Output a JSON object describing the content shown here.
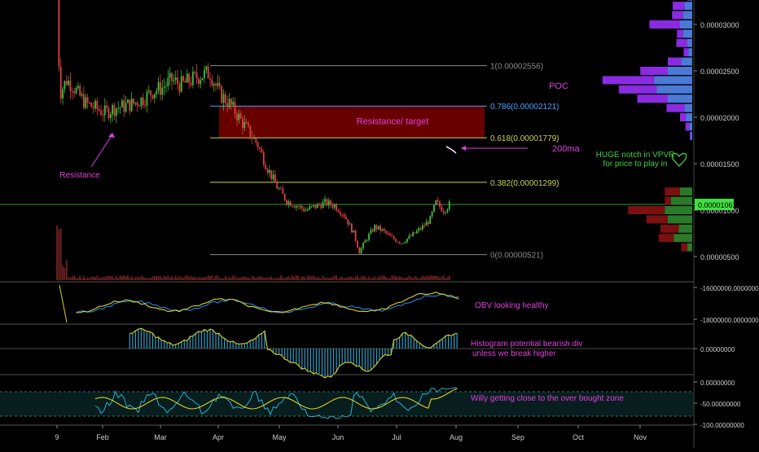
{
  "chart_data": {
    "type": "candlestick",
    "x_axis": {
      "labels": [
        "9",
        "Feb",
        "Mar",
        "Apr",
        "May",
        "Jun",
        "Jul",
        "Aug",
        "Sep",
        "Oct",
        "Nov"
      ]
    },
    "price_axis": {
      "ticks": [
        "0.00003000",
        "0.00002500",
        "0.00002000",
        "0.00001500",
        "0.00001000",
        "0.00000500"
      ],
      "current_price": "0.00001061"
    },
    "price_series": [
      {
        "t": 0,
        "v": 3.55e-05
      },
      {
        "t": 1,
        "v": 2.6e-05
      },
      {
        "t": 2,
        "v": 2.28e-05
      },
      {
        "t": 5,
        "v": 2.4e-05
      },
      {
        "t": 8,
        "v": 2.35e-05
      },
      {
        "t": 11,
        "v": 2.25e-05
      },
      {
        "t": 15,
        "v": 2.15e-05
      },
      {
        "t": 20,
        "v": 2.1e-05
      },
      {
        "t": 25,
        "v": 2.05e-05
      },
      {
        "t": 30,
        "v": 2.1e-05
      },
      {
        "t": 35,
        "v": 2.12e-05
      },
      {
        "t": 40,
        "v": 2.15e-05
      },
      {
        "t": 45,
        "v": 2.2e-05
      },
      {
        "t": 50,
        "v": 2.28e-05
      },
      {
        "t": 55,
        "v": 2.32e-05
      },
      {
        "t": 60,
        "v": 2.4e-05
      },
      {
        "t": 65,
        "v": 2.35e-05
      },
      {
        "t": 70,
        "v": 2.4e-05
      },
      {
        "t": 75,
        "v": 2.45e-05
      },
      {
        "t": 80,
        "v": 2.48e-05
      },
      {
        "t": 85,
        "v": 2.25e-05
      },
      {
        "t": 90,
        "v": 2.15e-05
      },
      {
        "t": 95,
        "v": 2e-05
      },
      {
        "t": 100,
        "v": 1.85e-05
      },
      {
        "t": 105,
        "v": 1.7e-05
      },
      {
        "t": 110,
        "v": 1.45e-05
      },
      {
        "t": 115,
        "v": 1.25e-05
      },
      {
        "t": 120,
        "v": 1.1e-05
      },
      {
        "t": 125,
        "v": 1.05e-05
      },
      {
        "t": 130,
        "v": 1e-05
      },
      {
        "t": 135,
        "v": 1.04e-05
      },
      {
        "t": 140,
        "v": 1.08e-05
      },
      {
        "t": 145,
        "v": 1.05e-05
      },
      {
        "t": 150,
        "v": 9.5e-06
      },
      {
        "t": 155,
        "v": 7.5e-06
      },
      {
        "t": 158,
        "v": 5.5e-06
      },
      {
        "t": 162,
        "v": 7e-06
      },
      {
        "t": 166,
        "v": 8.2e-06
      },
      {
        "t": 170,
        "v": 7.8e-06
      },
      {
        "t": 175,
        "v": 7e-06
      },
      {
        "t": 180,
        "v": 6.5e-06
      },
      {
        "t": 185,
        "v": 7.2e-06
      },
      {
        "t": 190,
        "v": 8e-06
      },
      {
        "t": 195,
        "v": 9e-06
      },
      {
        "t": 198,
        "v": 1.08e-05
      },
      {
        "t": 202,
        "v": 1e-05
      },
      {
        "t": 205,
        "v": 1.06e-05
      }
    ],
    "fib_levels": [
      {
        "label": "1(0.00002556)",
        "price": 2.556e-05
      },
      {
        "label": "0.786(0.00002121)",
        "price": 2.121e-05
      },
      {
        "label": "0.618(0.00001779)",
        "price": 1.779e-05
      },
      {
        "label": "0.382(0.00001299)",
        "price": 1.299e-05
      },
      {
        "label": "0(0.00000521)",
        "price": 5.21e-06
      }
    ],
    "resistance_zone": {
      "label": "Resistance/ target",
      "top": 2.12e-05,
      "bottom": 1.78e-05
    },
    "annotations": {
      "resistance": "Resistance",
      "ma200": "200ma",
      "poc": "POC",
      "vpvr_note_1": "HUGE notch in VPVR",
      "vpvr_note_2": "for price to play in"
    },
    "volume_profile": [
      {
        "price": 3.3e-05,
        "up": 5,
        "down": 3
      },
      {
        "price": 3.2e-05,
        "up": 12,
        "down": 20
      },
      {
        "price": 3.1e-05,
        "up": 15,
        "down": 18
      },
      {
        "price": 3e-05,
        "up": 20,
        "down": 50
      },
      {
        "price": 2.9e-05,
        "up": 15,
        "down": 10
      },
      {
        "price": 2.8e-05,
        "up": 8,
        "down": 18
      },
      {
        "price": 2.7e-05,
        "up": 6,
        "down": 8
      },
      {
        "price": 2.6e-05,
        "up": 18,
        "down": 22
      },
      {
        "price": 2.5e-05,
        "up": 40,
        "down": 45
      },
      {
        "price": 2.4e-05,
        "up": 62,
        "down": 85
      },
      {
        "price": 2.3e-05,
        "up": 58,
        "down": 62
      },
      {
        "price": 2.2e-05,
        "up": 40,
        "down": 50
      },
      {
        "price": 2.1e-05,
        "up": 12,
        "down": 30
      },
      {
        "price": 2e-05,
        "up": 10,
        "down": 10
      },
      {
        "price": 1.9e-05,
        "up": 5,
        "down": 6
      },
      {
        "price": 1.8e-05,
        "up": 2,
        "down": 2
      },
      {
        "price": 1.2e-05,
        "up": 20,
        "down": 25
      },
      {
        "price": 1.1e-05,
        "up": 35,
        "down": 10
      },
      {
        "price": 1e-05,
        "up": 45,
        "down": 60
      },
      {
        "price": 9e-06,
        "up": 40,
        "down": 35
      },
      {
        "price": 8e-06,
        "up": 22,
        "down": 30
      },
      {
        "price": 7e-06,
        "up": 30,
        "down": 25
      },
      {
        "price": 6e-06,
        "up": 8,
        "down": 10
      }
    ],
    "obv_panel": {
      "label": "OBV looking healthy",
      "ticks": [
        "-16000000.00000000",
        "-18000000.00000000"
      ]
    },
    "histogram_panel": {
      "label_1": "Histogram potential bearish div",
      "label_2": "unless we break higher",
      "ticks": [
        "0.00000000"
      ]
    },
    "willy_panel": {
      "label": "Willy getting close to the over bought zone",
      "ticks": [
        "0.00000000",
        "-50.00000000",
        "-100.00000000"
      ]
    }
  }
}
